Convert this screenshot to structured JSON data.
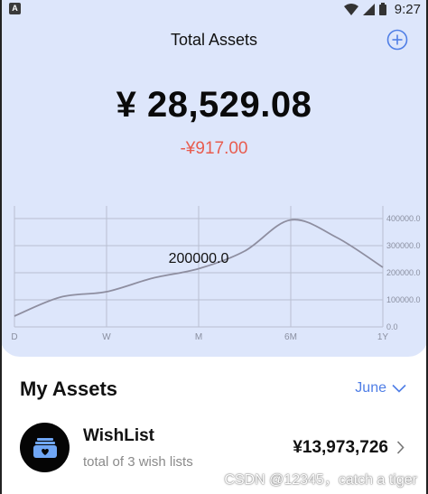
{
  "status_bar": {
    "app_icon_letter": "A",
    "time": "9:27",
    "icons": [
      "wifi-icon",
      "signal-icon",
      "battery-icon"
    ]
  },
  "header": {
    "title": "Total Assets",
    "add_icon": "plus-circle-icon"
  },
  "summary": {
    "total": "¥ 28,529.08",
    "change": "-¥917.00",
    "change_color": "#e85c4f"
  },
  "chart_data": {
    "type": "line",
    "categories": [
      "D",
      "W",
      "M",
      "6M",
      "1Y"
    ],
    "y_ticks": [
      "0.0",
      "100000.0",
      "200000.0",
      "300000.0",
      "400000.0"
    ],
    "ylim": [
      0,
      400000
    ],
    "x": [
      0,
      0.5,
      1,
      1.5,
      2,
      2.5,
      3,
      3.5,
      4
    ],
    "values": [
      40000,
      110000,
      130000,
      180000,
      215000,
      280000,
      395000,
      330000,
      220000
    ],
    "annotation": "200000.0",
    "line_color": "#8e8ea0",
    "grid": true
  },
  "assets": {
    "title": "My Assets",
    "month": "June",
    "items": [
      {
        "icon": "wishlist-box-icon",
        "name": "WishList",
        "subtitle": "total of 3 wish lists",
        "value": "¥13,973,726"
      }
    ]
  },
  "watermark": "CSDN @12345，catch a tiger",
  "colors": {
    "panel_bg": "#dde6fb",
    "accent": "#4f7ee6"
  }
}
